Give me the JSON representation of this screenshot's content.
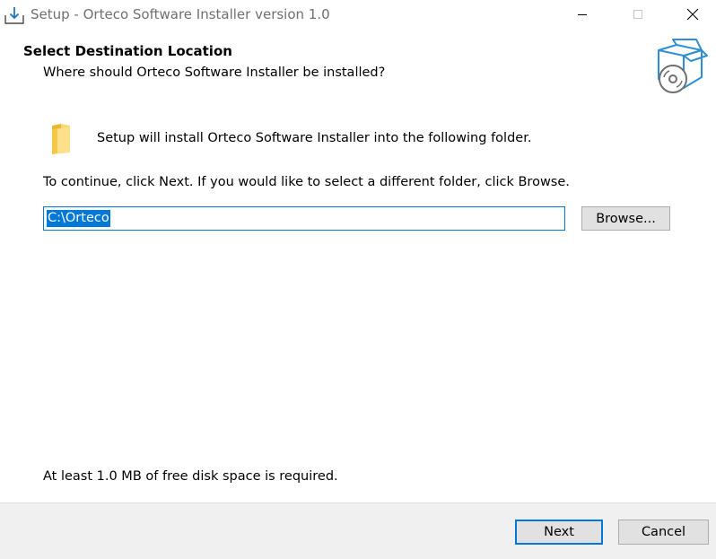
{
  "window": {
    "title": "Setup - Orteco Software Installer version 1.0",
    "app_icon": "installer-download-icon",
    "controls": [
      "minimize-icon",
      "maximize-icon",
      "close-icon"
    ]
  },
  "header": {
    "title": "Select Destination Location",
    "subtitle": "Where should Orteco Software Installer be installed?",
    "logo_icon": "box-disc-icon"
  },
  "body": {
    "folder_icon": "folder-icon",
    "install_text": "Setup will install Orteco Software Installer into the following folder.",
    "continue_text": "To continue, click Next. If you would like to select a different folder, click Browse.",
    "path_value": "C:\\Orteco",
    "browse_label": "Browse...",
    "disk_space_text": "At least 1.0 MB of free disk space is required."
  },
  "footer": {
    "next_label": "Next",
    "cancel_label": "Cancel"
  },
  "colors": {
    "accent": "#0078d7",
    "footer_bg": "#f0f0f0",
    "button_bg": "#e1e1e1",
    "logo_blue": "#2f8fd0"
  }
}
